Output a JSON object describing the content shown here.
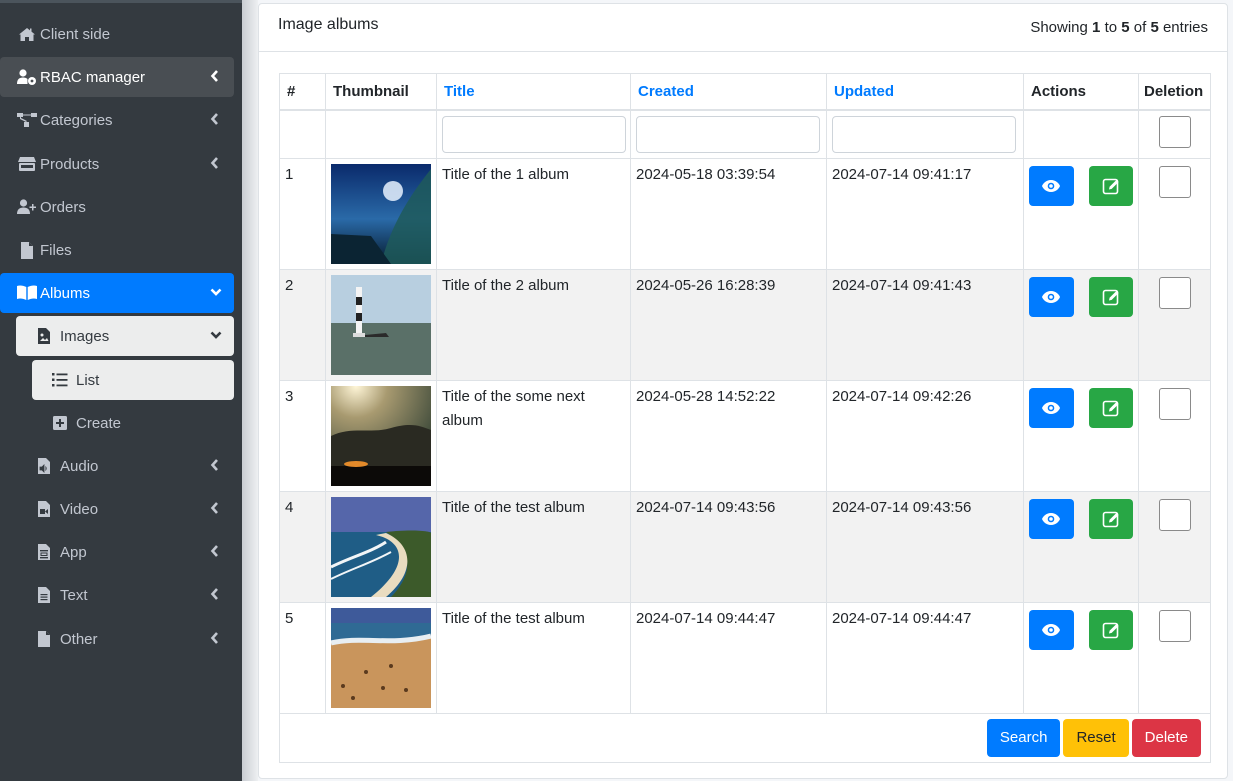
{
  "sidebar": {
    "items": [
      {
        "label": "Client side",
        "icon": "home-icon"
      },
      {
        "label": "RBAC manager",
        "icon": "user-gear-icon"
      },
      {
        "label": "Categories",
        "icon": "sitemap-icon"
      },
      {
        "label": "Products",
        "icon": "store-icon"
      },
      {
        "label": "Orders",
        "icon": "user-plus-icon"
      },
      {
        "label": "Files",
        "icon": "file-icon"
      },
      {
        "label": "Albums",
        "icon": "book-open-icon"
      },
      {
        "label": "Images",
        "icon": "file-image-icon"
      },
      {
        "label": "List",
        "icon": "list-icon"
      },
      {
        "label": "Create",
        "icon": "plus-square-icon"
      },
      {
        "label": "Audio",
        "icon": "file-audio-icon"
      },
      {
        "label": "Video",
        "icon": "file-video-icon"
      },
      {
        "label": "App",
        "icon": "file-app-icon"
      },
      {
        "label": "Text",
        "icon": "file-text-icon"
      },
      {
        "label": "Other",
        "icon": "file-icon"
      }
    ]
  },
  "card": {
    "title": "Image albums",
    "summary": {
      "prefix": "Showing",
      "from": "1",
      "to_word": "to",
      "to": "5",
      "of_word": "of",
      "total": "5",
      "suffix": "entries"
    }
  },
  "table": {
    "columns": [
      "#",
      "Thumbnail",
      "Title",
      "Created",
      "Updated",
      "Actions",
      "Deletion"
    ],
    "filters": {
      "title": "",
      "created": "",
      "updated": ""
    },
    "rows": [
      {
        "num": "1",
        "thumbnail": "ocean-wave",
        "title": "Title of the 1 album",
        "created": "2024-05-18 03:39:54",
        "updated": "2024-07-14 09:41:17"
      },
      {
        "num": "2",
        "thumbnail": "lighthouse-at-sea",
        "title": "Title of the 2 album",
        "created": "2024-05-26 16:28:39",
        "updated": "2024-07-14 09:41:43"
      },
      {
        "num": "3",
        "thumbnail": "sunrays-over-clouds",
        "title": "Title of the some next album",
        "created": "2024-05-28 14:52:22",
        "updated": "2024-07-14 09:42:26"
      },
      {
        "num": "4",
        "thumbnail": "coastal-bay",
        "title": "Title of the test album",
        "created": "2024-07-14 09:43:56",
        "updated": "2024-07-14 09:43:56"
      },
      {
        "num": "5",
        "thumbnail": "beach-footprints",
        "title": "Title of the test album",
        "created": "2024-07-14 09:44:47",
        "updated": "2024-07-14 09:44:47"
      }
    ]
  },
  "footer": {
    "search": "Search",
    "reset": "Reset",
    "delete": "Delete"
  },
  "colors": {
    "primary": "#007bff",
    "success": "#28a745",
    "warning": "#ffc107",
    "danger": "#dc3545",
    "sidebar": "#343a40"
  }
}
